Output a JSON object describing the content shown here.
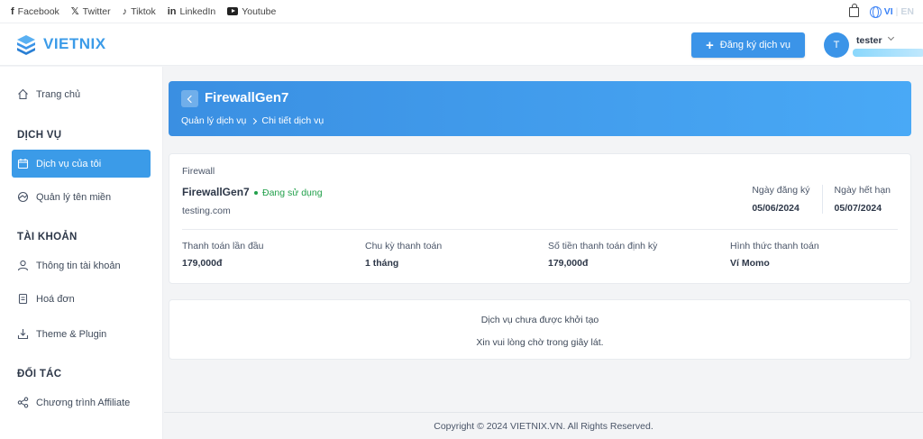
{
  "social": [
    {
      "icon": "facebook-icon",
      "glyph": "f",
      "label": "Facebook"
    },
    {
      "icon": "x-twitter-icon",
      "glyph": "𝕏",
      "label": "Twitter"
    },
    {
      "icon": "tiktok-icon",
      "glyph": "♪",
      "label": "Tiktok"
    },
    {
      "icon": "linkedin-icon",
      "glyph": "in",
      "label": "LinkedIn"
    },
    {
      "icon": "youtube-icon",
      "glyph": "",
      "label": "Youtube"
    }
  ],
  "lang": {
    "active": "VI",
    "separator": "|",
    "other": "EN"
  },
  "brand": {
    "name": "VIETNIX",
    "color": "#3b9be8"
  },
  "header": {
    "register_label": "Đăng ký dịch vụ",
    "user_initial": "T",
    "username": "tester"
  },
  "sidebar": {
    "home": "Trang chủ",
    "section_services": "DỊCH VỤ",
    "my_services": "Dịch vụ của tôi",
    "domains": "Quản lý tên miền",
    "section_account": "TÀI KHOẢN",
    "account_info": "Thông tin tài khoản",
    "invoices": "Hoá đơn",
    "theme_plugin": "Theme & Plugin",
    "section_partner": "ĐỐI TÁC",
    "affiliate": "Chương trình Affiliate"
  },
  "banner": {
    "title": "FirewallGen7",
    "crumb1": "Quản lý dịch vụ",
    "crumb2": "Chi tiết dịch vụ"
  },
  "service": {
    "type": "Firewall",
    "name": "FirewallGen7",
    "status": "Đang sử dụng",
    "domain": "testing.com",
    "reg_label": "Ngày đăng ký",
    "reg_date": "05/06/2024",
    "exp_label": "Ngày hết hạn",
    "exp_date": "05/07/2024"
  },
  "metrics": [
    {
      "label": "Thanh toán lần đầu",
      "value": "179,000đ"
    },
    {
      "label": "Chu kỳ thanh toán",
      "value": "1 tháng"
    },
    {
      "label": "Số tiền thanh toán định kỳ",
      "value": "179,000đ"
    },
    {
      "label": "Hình thức thanh toán",
      "value": "Ví Momo"
    }
  ],
  "notice": {
    "title": "Dịch vụ chưa được khởi tạo",
    "sub": "Xin vui lòng chờ trong giây lát."
  },
  "footer": "Copyright © 2024 VIETNIX.VN. All Rights Reserved.",
  "colors": {
    "accent": "#3b94e8",
    "status_active": "#22a04b"
  }
}
